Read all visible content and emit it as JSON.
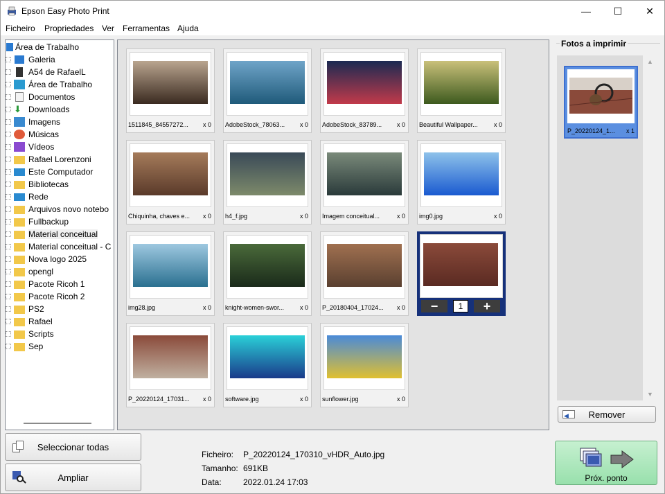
{
  "window": {
    "title": "Epson Easy Photo Print",
    "minimize": "—",
    "maximize": "☐",
    "close": "✕"
  },
  "menu": [
    "Ficheiro",
    "Propriedades",
    "Ver",
    "Ferramentas",
    "Ajuda"
  ],
  "tree": {
    "root": "Área de Trabalho",
    "items": [
      {
        "label": "Galeria",
        "icon": "gallery-icon"
      },
      {
        "label": "A54 de RafaelL",
        "icon": "phone-icon"
      },
      {
        "label": "Área de Trabalho",
        "icon": "desktop-icon"
      },
      {
        "label": "Documentos",
        "icon": "documents-icon"
      },
      {
        "label": "Downloads",
        "icon": "downloads-icon"
      },
      {
        "label": "Imagens",
        "icon": "pictures-icon"
      },
      {
        "label": "Músicas",
        "icon": "music-icon"
      },
      {
        "label": "Vídeos",
        "icon": "videos-icon"
      },
      {
        "label": "Rafael Lorenzoni",
        "icon": "folder-icon"
      },
      {
        "label": "Este Computador",
        "icon": "computer-icon"
      },
      {
        "label": "Bibliotecas",
        "icon": "folder-icon"
      },
      {
        "label": "Rede",
        "icon": "network-icon"
      },
      {
        "label": "Arquivos novo notebo",
        "icon": "folder-icon"
      },
      {
        "label": "Fullbackup",
        "icon": "folder-icon"
      },
      {
        "label": "Material conceitual",
        "icon": "folder-icon"
      },
      {
        "label": "Material conceitual - C",
        "icon": "folder-icon"
      },
      {
        "label": "Nova logo 2025",
        "icon": "folder-icon"
      },
      {
        "label": "opengl",
        "icon": "folder-icon"
      },
      {
        "label": "Pacote Ricoh 1",
        "icon": "folder-icon"
      },
      {
        "label": "Pacote Ricoh 2",
        "icon": "folder-icon"
      },
      {
        "label": "PS2",
        "icon": "folder-icon"
      },
      {
        "label": "Rafael",
        "icon": "folder-icon"
      },
      {
        "label": "Scripts",
        "icon": "folder-icon"
      },
      {
        "label": "Sep",
        "icon": "folder-icon"
      }
    ]
  },
  "photos": [
    {
      "name": "1511845_84557272...",
      "count": "x 0",
      "colors": [
        "#b9a58f",
        "#3a2a20"
      ]
    },
    {
      "name": "AdobeStock_78063...",
      "count": "x 0",
      "colors": [
        "#6fa4c8",
        "#1f5a7a"
      ]
    },
    {
      "name": "AdobeStock_83789...",
      "count": "x 0",
      "colors": [
        "#1b2a52",
        "#c23a4a"
      ]
    },
    {
      "name": "Beautiful Wallpaper...",
      "count": "x 0",
      "colors": [
        "#c9c07a",
        "#3d5a1e"
      ]
    },
    {
      "name": "Chiquinha, chaves e...",
      "count": "x 0",
      "colors": [
        "#a57b5a",
        "#5a3a2a"
      ]
    },
    {
      "name": "h4_f.jpg",
      "count": "x 0",
      "colors": [
        "#3a4a58",
        "#7d8a6a"
      ]
    },
    {
      "name": "Imagem conceitual...",
      "count": "x 0",
      "colors": [
        "#7a8a7a",
        "#2a3a3a"
      ]
    },
    {
      "name": "img0.jpg",
      "count": "x 0",
      "colors": [
        "#8ec2ea",
        "#1a5ad0"
      ]
    },
    {
      "name": "img28.jpg",
      "count": "x 0",
      "colors": [
        "#9ec8e0",
        "#2a7090"
      ]
    },
    {
      "name": "knight-women-swor...",
      "count": "x 0",
      "colors": [
        "#4a6a3a",
        "#1a2a1a"
      ]
    },
    {
      "name": "P_20180404_17024...",
      "count": "x 0",
      "colors": [
        "#a07050",
        "#5a4030"
      ]
    },
    {
      "name": "P_20220124_17031...",
      "count": "1",
      "colors": [
        "#8a4a3a",
        "#5a2a22"
      ],
      "active": true
    },
    {
      "name": "P_20220124_17031...",
      "count": "x 0",
      "colors": [
        "#8a4a3a",
        "#c0b0a0"
      ]
    },
    {
      "name": "software.jpg",
      "count": "x 0",
      "colors": [
        "#2ad0d8",
        "#1a3a8a"
      ]
    },
    {
      "name": "sunflower.jpg",
      "count": "x 0",
      "colors": [
        "#4a8ad8",
        "#e0c030"
      ]
    }
  ],
  "stepper": {
    "minus": "−",
    "plus": "+",
    "value": "1"
  },
  "print_panel": {
    "title": "Fotos a imprimir",
    "item_name": "P_20220124_1...",
    "item_count": "x 1",
    "remove_label": "Remover",
    "scroll_up": "▲",
    "scroll_down": "▼"
  },
  "buttons": {
    "select_all": "Seleccionar todas",
    "zoom": "Ampliar",
    "next": "Próx. ponto"
  },
  "info": {
    "file_key": "Ficheiro:",
    "file_val": "P_20220124_170310_vHDR_Auto.jpg",
    "size_key": "Tamanho:",
    "size_val": "691KB",
    "date_key": "Data:",
    "date_val": "2022.01.24 17:03"
  }
}
